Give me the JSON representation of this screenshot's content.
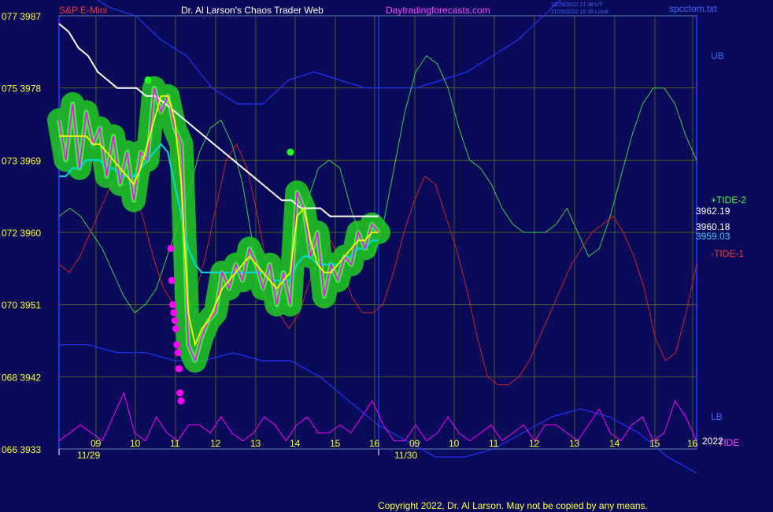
{
  "header": {
    "symbol": "S&P E-Mini",
    "title": "Dr. Al Larson's Chaos Trader Web",
    "site": "Daytradingforecasts.com",
    "timestamp_1": "11/29/2022 21:38 UT",
    "timestamp_2": "11/29/2022 16:38 Local",
    "file": "spcctom.txt"
  },
  "footer": {
    "copyright": "Copyright 2022, Dr. Al Larson. May not be copied by any means."
  },
  "colors": {
    "background": "#0a0a5a",
    "frame": "#2233dd",
    "grid": "#4a5a2a",
    "price": "#ff00ff",
    "smooth": "#ffff00",
    "band": "#22cc22",
    "avg_fast": "#00dddd",
    "avg_slow": "#ffffff",
    "tide_plus": "#44cc44",
    "tide_minus": "#cc2222",
    "envelope": "#2233ff",
    "tide_osc": "#ff00ff",
    "marker": "#ff00ff",
    "peak": "#22ff22"
  },
  "chart_data": {
    "type": "line",
    "y_axis": {
      "ylim": [
        3933,
        3987
      ],
      "ticks": [
        {
          "cycle": "077",
          "price": 3987
        },
        {
          "cycle": "075",
          "price": 3978
        },
        {
          "cycle": "073",
          "price": 3969
        },
        {
          "cycle": "072",
          "price": 3960
        },
        {
          "cycle": "070",
          "price": 3951
        },
        {
          "cycle": "068",
          "price": 3942
        },
        {
          "cycle": "066",
          "price": 3933
        }
      ]
    },
    "x_axis": {
      "ticks": [
        "09",
        "10",
        "11",
        "12",
        "13",
        "14",
        "15",
        "16",
        "09",
        "10",
        "11",
        "12",
        "13",
        "14",
        "15",
        "16"
      ],
      "dates": [
        "11/29",
        "11/30"
      ]
    },
    "right_labels": {
      "ub": "UB",
      "tide_plus": "+TIDE-2",
      "price_1": "3962.19",
      "price_2": "3960.18",
      "price_3": "3959.03",
      "tide_minus": "-TIDE-1",
      "lb": "LB",
      "tide": "TIDE",
      "year": "2022"
    },
    "series": [
      {
        "key": "price",
        "values": [
          3974,
          3969,
          3976,
          3968,
          3975,
          3971,
          3973,
          3967,
          3972,
          3966,
          3970,
          3964,
          3970,
          3969,
          3978,
          3975,
          3977,
          3973,
          3971,
          3946,
          3944,
          3947,
          3949,
          3950,
          3955,
          3953,
          3956,
          3954,
          3958,
          3956,
          3953,
          3956,
          3951,
          3955,
          3951,
          3965,
          3963,
          3957,
          3960,
          3952,
          3956,
          3954,
          3957,
          3956,
          3960,
          3958,
          3961,
          3960
        ]
      },
      {
        "key": "smooth",
        "values": [
          3972,
          3972,
          3972,
          3972,
          3972,
          3971,
          3971,
          3970,
          3969,
          3968,
          3967,
          3966,
          3968,
          3971,
          3974,
          3977,
          3977,
          3974,
          3966,
          3950,
          3946,
          3948,
          3949,
          3951,
          3953,
          3954,
          3955,
          3956,
          3957,
          3956,
          3955,
          3954,
          3953,
          3954,
          3955,
          3962,
          3963,
          3959,
          3956,
          3955,
          3955,
          3956,
          3957,
          3958,
          3959,
          3959,
          3960,
          3960
        ]
      },
      {
        "key": "avg_fast",
        "values": [
          3967,
          3967,
          3968,
          3968,
          3969,
          3969,
          3969,
          3968,
          3968,
          3967,
          3967,
          3967,
          3968,
          3969,
          3970,
          3971,
          3970,
          3966,
          3962,
          3958,
          3956,
          3955,
          3955,
          3955,
          3955,
          3955,
          3955,
          3955,
          3955,
          3955,
          3955,
          3954,
          3954,
          3954,
          3954,
          3956,
          3957,
          3957,
          3956,
          3956,
          3956,
          3956,
          3957,
          3957,
          3958,
          3958,
          3959,
          3959
        ]
      },
      {
        "key": "avg_slow",
        "values": [
          3986,
          3985,
          3983,
          3982,
          3980,
          3979,
          3978,
          3978,
          3978,
          3977,
          3977,
          3976,
          3975,
          3974,
          3973,
          3972,
          3971,
          3970,
          3969,
          3968,
          3967,
          3966,
          3965,
          3964,
          3964,
          3963,
          3963,
          3963,
          3962,
          3962,
          3962,
          3962,
          3962,
          3962
        ]
      },
      {
        "key": "tide_plus",
        "values": [
          3962,
          3963,
          3962,
          3960,
          3958,
          3955,
          3952,
          3950,
          3951,
          3953,
          3957,
          3961,
          3965,
          3970,
          3973,
          3974,
          3971,
          3966,
          3958,
          3952,
          3950,
          3953,
          3958,
          3964,
          3968,
          3969,
          3968,
          3963,
          3959,
          3957,
          3961,
          3968,
          3975,
          3980,
          3982,
          3981,
          3978,
          3973,
          3969,
          3968,
          3966,
          3963,
          3961,
          3960,
          3960,
          3960,
          3961,
          3963,
          3960,
          3957,
          3958,
          3962,
          3967,
          3972,
          3976,
          3978,
          3978,
          3976,
          3972,
          3969
        ]
      },
      {
        "key": "tide_minus",
        "values": [
          3956,
          3955,
          3957,
          3960,
          3963,
          3966,
          3968,
          3966,
          3962,
          3957,
          3953,
          3951,
          3950,
          3952,
          3957,
          3963,
          3969,
          3971,
          3968,
          3962,
          3955,
          3950,
          3948,
          3950,
          3954,
          3957,
          3959,
          3956,
          3952,
          3950,
          3950,
          3951,
          3955,
          3960,
          3964,
          3967,
          3966,
          3962,
          3958,
          3953,
          3947,
          3942,
          3941,
          3941,
          3942,
          3944,
          3947,
          3950,
          3953,
          3956,
          3958,
          3960,
          3961,
          3962,
          3960,
          3957,
          3953,
          3947,
          3944,
          3945,
          3950,
          3956
        ]
      },
      {
        "key": "upper_envelope",
        "values": [
          3992,
          3990,
          3988,
          3987,
          3984,
          3982,
          3978,
          3976,
          3976,
          3979,
          3980,
          3979,
          3978,
          3978,
          3978,
          3979,
          3980,
          3982,
          3984,
          3987,
          3990,
          3993,
          3995,
          3996,
          3996,
          3995
        ]
      },
      {
        "key": "lower_envelope",
        "values": [
          3946,
          3946,
          3945,
          3945,
          3944,
          3944,
          3945,
          3944,
          3944,
          3942,
          3939,
          3936,
          3934,
          3932,
          3932,
          3933,
          3935,
          3937,
          3938,
          3937,
          3935,
          3932,
          3930
        ]
      },
      {
        "key": "tide_osc",
        "values": [
          3934,
          3935,
          3936,
          3935,
          3934,
          3937,
          3940,
          3935,
          3934,
          3937,
          3935,
          3934,
          3936,
          3936,
          3935,
          3937,
          3935,
          3934,
          3935,
          3937,
          3936,
          3934,
          3936,
          3937,
          3935,
          3935,
          3936,
          3935,
          3937,
          3939,
          3936,
          3934,
          3934,
          3936,
          3934,
          3935,
          3937,
          3935,
          3934,
          3935,
          3936,
          3934,
          3935,
          3936,
          3934,
          3936,
          3936,
          3935,
          3934,
          3936,
          3938,
          3935,
          3934,
          3936,
          3937,
          3934,
          3935,
          3939,
          3937,
          3934
        ]
      }
    ],
    "markers": [
      3958,
      3954,
      3951,
      3950,
      3949,
      3948,
      3946,
      3945,
      3943,
      3940,
      3939
    ],
    "peaks": [
      3979,
      3970
    ]
  }
}
